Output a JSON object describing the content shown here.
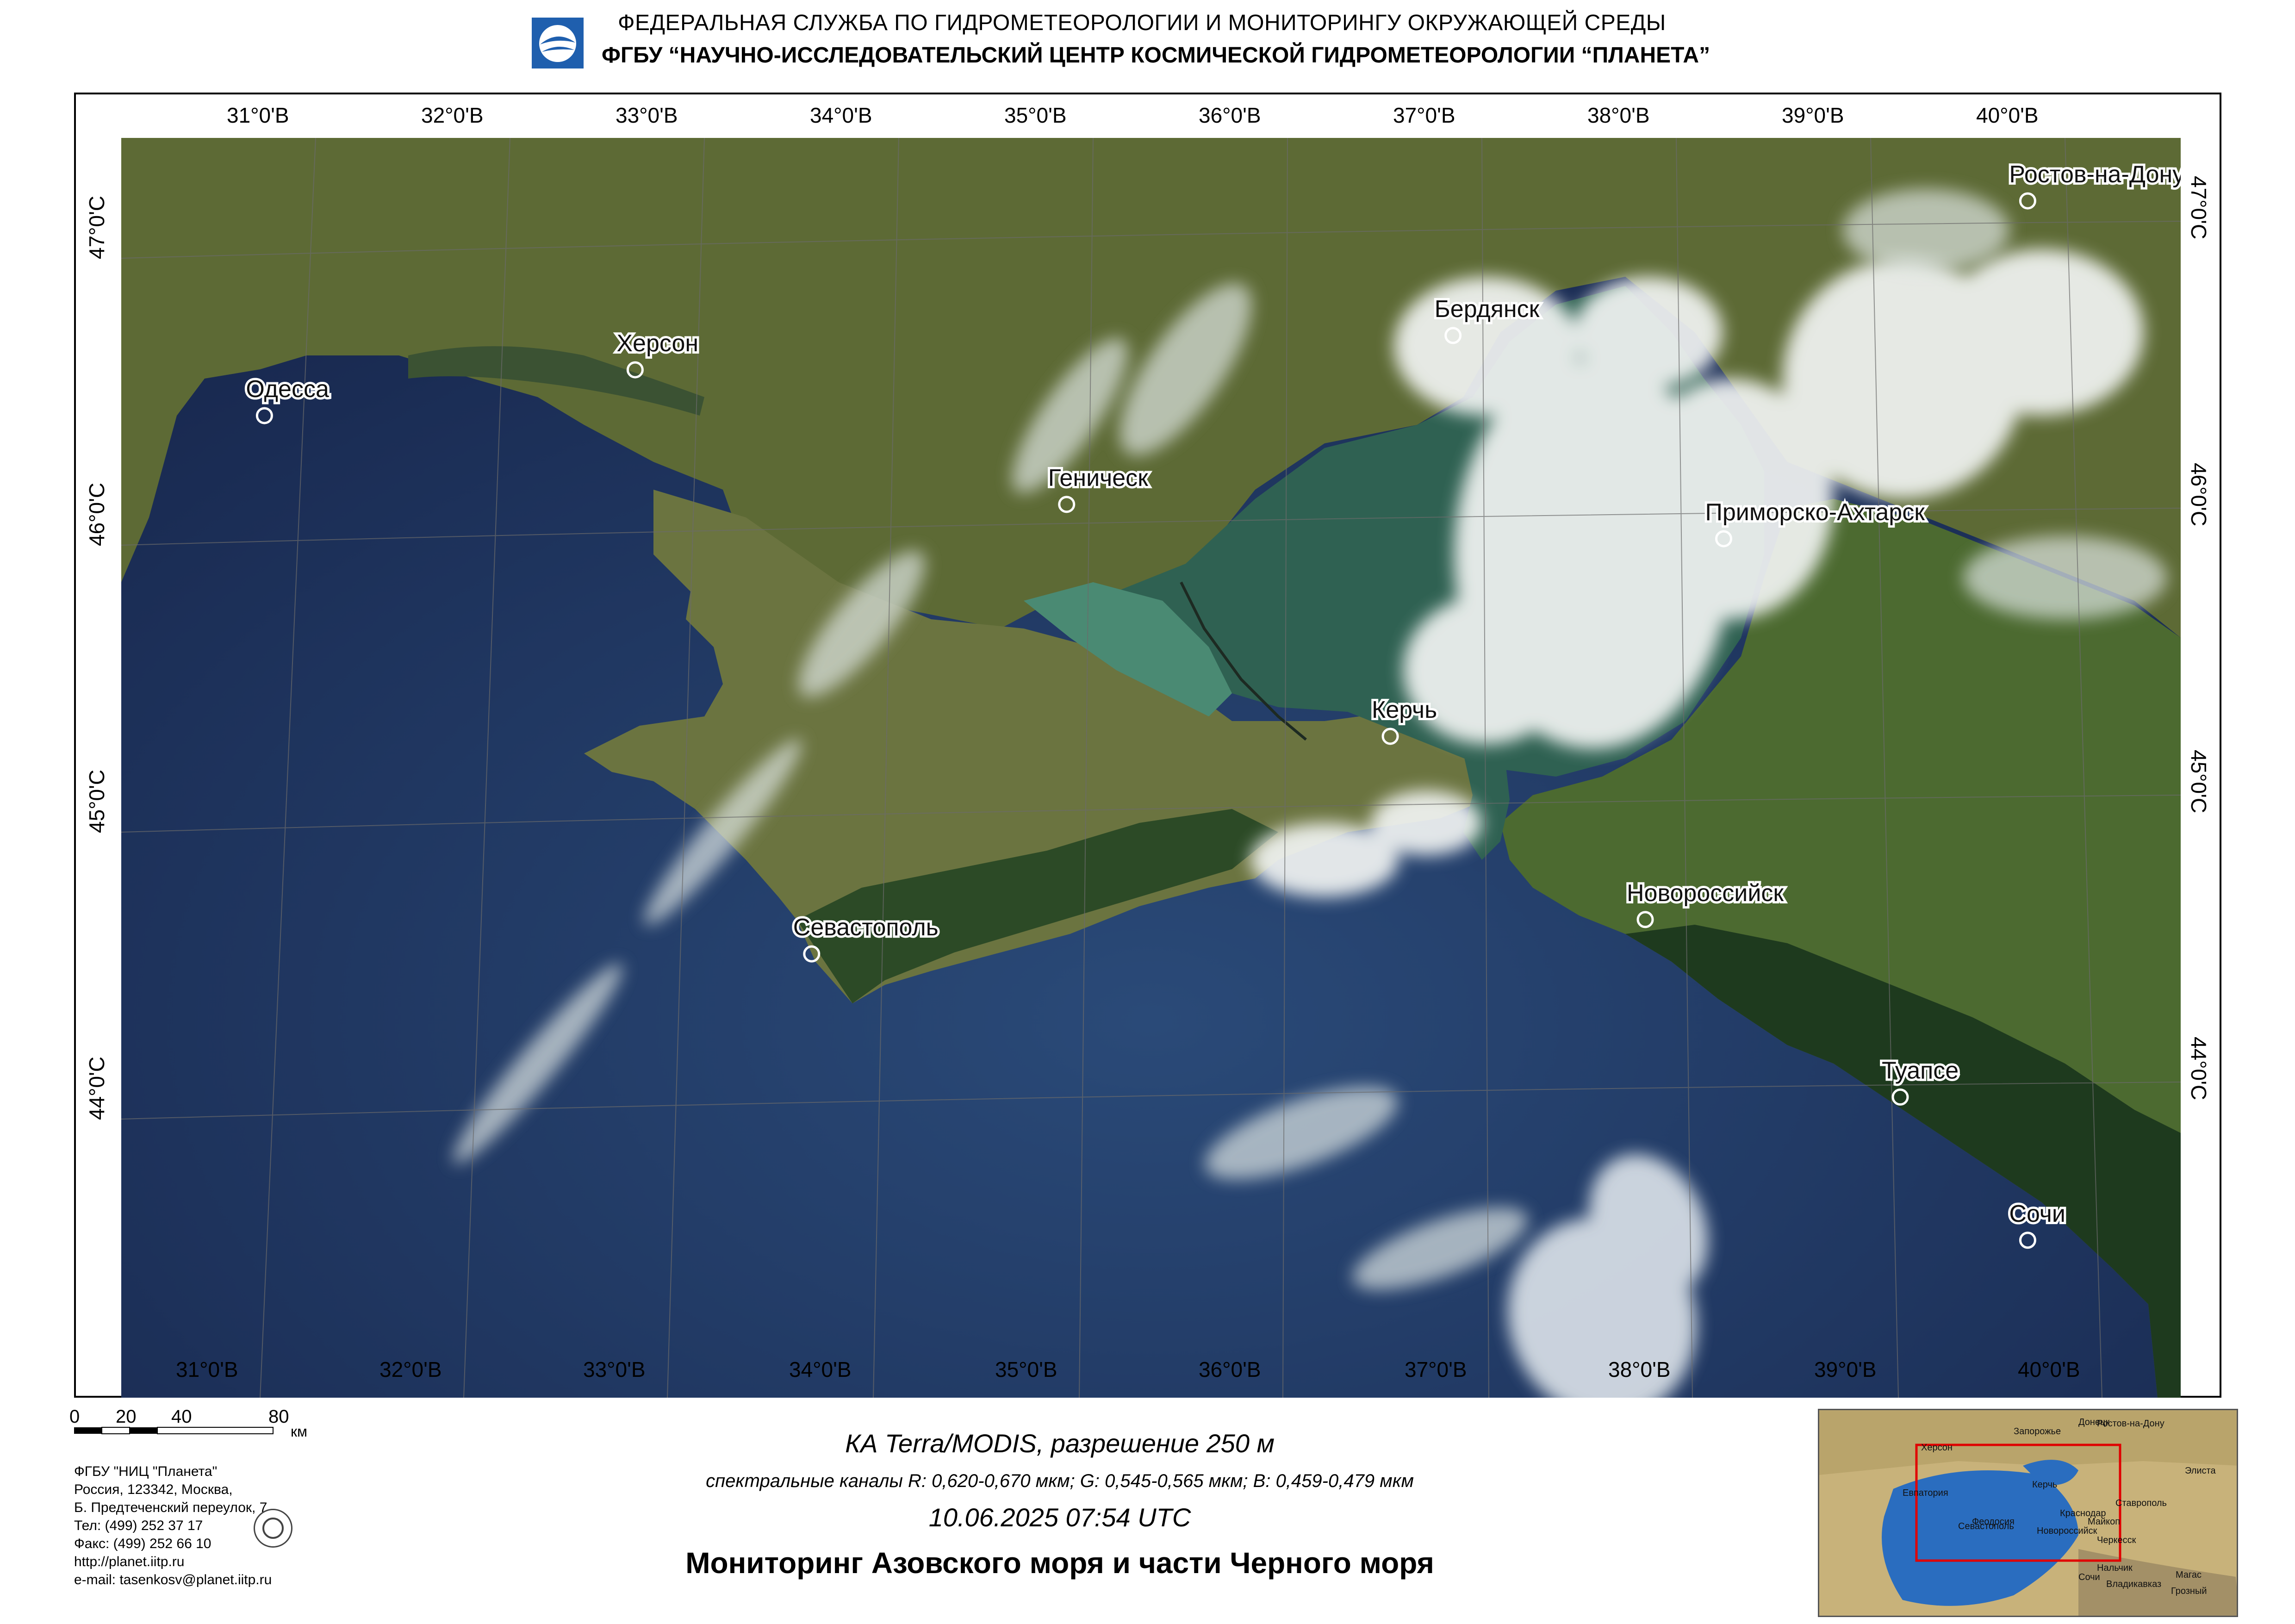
{
  "header": {
    "line1": "ФЕДЕРАЛЬНАЯ  СЛУЖБА  ПО ГИДРОМЕТЕОРОЛОГИИ И МОНИТОРИНГУ ОКРУЖАЮЩЕЙ СРЕДЫ",
    "line2": "ФГБУ “НАУЧНО-ИССЛЕДОВАТЕЛЬСКИЙ ЦЕНТР КОСМИЧЕСКОЙ ГИДРОМЕТЕОРОЛОГИИ “ПЛАНЕТА”"
  },
  "map": {
    "lon_ticks_top": [
      "31°0'В",
      "32°0'В",
      "33°0'В",
      "34°0'В",
      "35°0'В",
      "36°0'В",
      "37°0'В",
      "38°0'В",
      "39°0'В",
      "40°0'В"
    ],
    "lon_ticks_bottom": [
      "31°0'В",
      "32°0'В",
      "33°0'В",
      "34°0'В",
      "35°0'В",
      "36°0'В",
      "37°0'В",
      "38°0'В",
      "39°0'В",
      "40°0'В"
    ],
    "lat_ticks_left": [
      "47°0'С",
      "46°0'С",
      "45°0'С",
      "44°0'С"
    ],
    "lat_ticks_right": [
      "47°0'С",
      "46°0'С",
      "45°0'С",
      "44°0'С"
    ],
    "cities": [
      {
        "name": "Ростов-на-Дону",
        "lon": 39.72,
        "lat": 47.23
      },
      {
        "name": "Бердянск",
        "lon": 36.79,
        "lat": 46.76
      },
      {
        "name": "Херсон",
        "lon": 32.62,
        "lat": 46.64
      },
      {
        "name": "Одесса",
        "lon": 30.73,
        "lat": 46.48
      },
      {
        "name": "Геническ",
        "lon": 34.82,
        "lat": 46.17
      },
      {
        "name": "Приморско-Ахтарск",
        "lon": 38.17,
        "lat": 46.05
      },
      {
        "name": "Керчь",
        "lon": 36.47,
        "lat": 45.36
      },
      {
        "name": "Новороссийск",
        "lon": 37.77,
        "lat": 44.72
      },
      {
        "name": "Севастополь",
        "lon": 33.52,
        "lat": 44.6
      },
      {
        "name": "Туапсе",
        "lon": 39.07,
        "lat": 44.1
      },
      {
        "name": "Сочи",
        "lon": 39.72,
        "lat": 43.6
      }
    ],
    "colors": {
      "sea": "#1b2d52",
      "land": "#5a6b33",
      "azov": "#2f6152",
      "cloud": "#eef1f1"
    }
  },
  "scale_bar": {
    "labels": [
      "0",
      "20",
      "40",
      "80"
    ],
    "unit": "км"
  },
  "org_info": [
    "ФГБУ \"НИЦ \"Планета\"",
    "Россия, 123342,  Москва,",
    "Б. Предтеченский переулок, 7",
    "Тел: (499) 252 37 17",
    "Факс: (499) 252 66 10",
    "http://planet.iitp.ru",
    "e-mail: tasenkosv@planet.iitp.ru"
  ],
  "caption": {
    "satellite": "КА Terra/MODIS, разрешение 250 м",
    "channels": "спектральные каналы R: 0,620-0,670 мкм; G: 0,545-0,565 мкм;  B: 0,459-0,479 мкм",
    "datetime": "10.06.2025   07:54 UTC",
    "title": "Мониторинг Азовского моря и части Черного моря"
  },
  "inset_labels": [
    "Ростов-на-Дону",
    "Херсон",
    "Запорожье",
    "Донецк",
    "Элиста",
    "Евпатория",
    "Керчь",
    "Ставрополь",
    "Краснодар",
    "Майкоп",
    "Севастополь",
    "Феодосия",
    "Новороссийск",
    "Черкесск",
    "Нальчик",
    "Сочи",
    "Владикавказ",
    "Грозный",
    "Магас"
  ]
}
